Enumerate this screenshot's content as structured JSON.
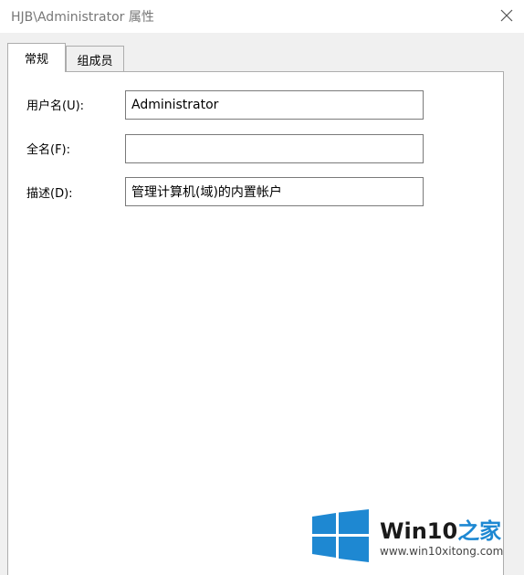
{
  "window": {
    "title": "HJB\\Administrator 属性"
  },
  "tabs": [
    {
      "label": "常规",
      "active": true
    },
    {
      "label": "组成员",
      "active": false
    }
  ],
  "fields": {
    "username": {
      "label": "用户名(U):",
      "value": "Administrator"
    },
    "fullname": {
      "label": "全名(F):",
      "value": ""
    },
    "description": {
      "label": "描述(D):",
      "value": "管理计算机(域)的内置帐户"
    }
  },
  "watermark": {
    "brand_main": "Win10",
    "brand_accent": "之家",
    "url": "www.win10xitong.com",
    "logo_color": "#1e88d2"
  },
  "icons": {
    "close": "close-icon",
    "logo": "windows-logo-icon"
  }
}
